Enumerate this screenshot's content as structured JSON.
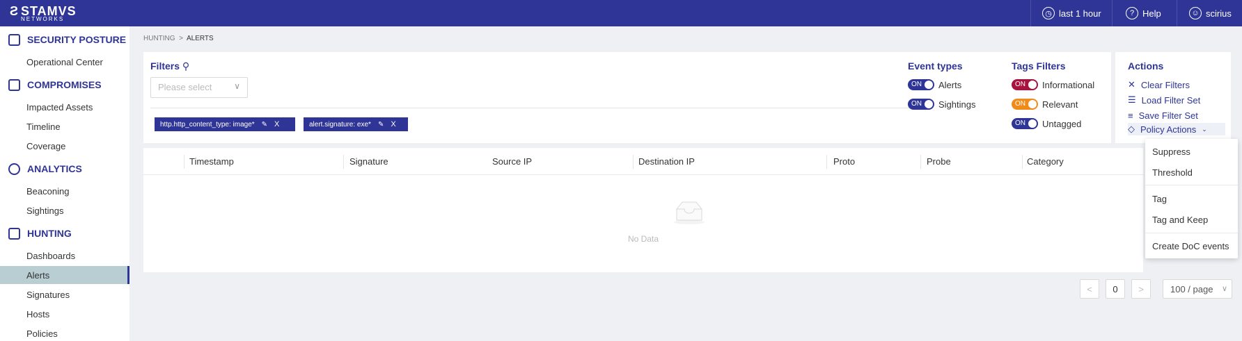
{
  "brand": {
    "name": "STAMVS",
    "sub": "NETWORKS"
  },
  "topbar": {
    "time_range": "last 1 hour",
    "help": "Help",
    "user": "scirius"
  },
  "sidebar": {
    "sections": [
      {
        "title": "SECURITY POSTURE",
        "items": [
          "Operational Center"
        ]
      },
      {
        "title": "COMPROMISES",
        "items": [
          "Impacted Assets",
          "Timeline",
          "Coverage"
        ]
      },
      {
        "title": "ANALYTICS",
        "items": [
          "Beaconing",
          "Sightings"
        ]
      },
      {
        "title": "HUNTING",
        "items": [
          "Dashboards",
          "Alerts",
          "Signatures",
          "Hosts",
          "Policies"
        ]
      }
    ],
    "active_item": "Alerts"
  },
  "breadcrumb": {
    "parent": "HUNTING",
    "separator": ">",
    "current": "ALERTS"
  },
  "filters": {
    "title": "Filters",
    "select_placeholder": "Please select",
    "chips": [
      {
        "label": "http.http_content_type: image*",
        "remove": "X"
      },
      {
        "label": "alert.signature: exe*",
        "remove": "X"
      }
    ]
  },
  "event_types": {
    "title": "Event types",
    "items": [
      {
        "state": "ON",
        "label": "Alerts"
      },
      {
        "state": "ON",
        "label": "Sightings"
      }
    ]
  },
  "tags_filters": {
    "title": "Tags Filters",
    "items": [
      {
        "state": "ON",
        "label": "Informational",
        "color": "#a8123e"
      },
      {
        "state": "ON",
        "label": "Relevant",
        "color": "#f08a18"
      },
      {
        "state": "ON",
        "label": "Untagged",
        "color": "#2f3596"
      }
    ]
  },
  "actions": {
    "title": "Actions",
    "items": [
      "Clear Filters",
      "Load Filter Set",
      "Save Filter Set",
      "Policy Actions"
    ]
  },
  "policy_menu": {
    "items": [
      "Suppress",
      "Threshold",
      "Tag",
      "Tag and Keep",
      "Create DoC events"
    ]
  },
  "table": {
    "columns": [
      "Timestamp",
      "Signature",
      "Source IP",
      "Destination IP",
      "Proto",
      "Probe",
      "Category"
    ],
    "empty_text": "No Data"
  },
  "pagination": {
    "prev": "<",
    "page": "0",
    "next": ">",
    "page_size": "100 / page"
  },
  "colors": {
    "primary": "#2f3596",
    "active_bg": "#b8ced3"
  }
}
